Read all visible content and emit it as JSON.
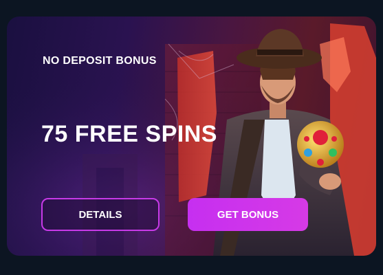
{
  "promo": {
    "eyebrow": "NO DEPOSIT BONUS",
    "headline": "75 FREE SPINS"
  },
  "buttons": {
    "details_label": "DETAILS",
    "get_bonus_label": "GET BONUS"
  },
  "colors": {
    "page_background": "#0c1522",
    "accent_magenta": "#c62ff0",
    "text": "#ffffff"
  }
}
